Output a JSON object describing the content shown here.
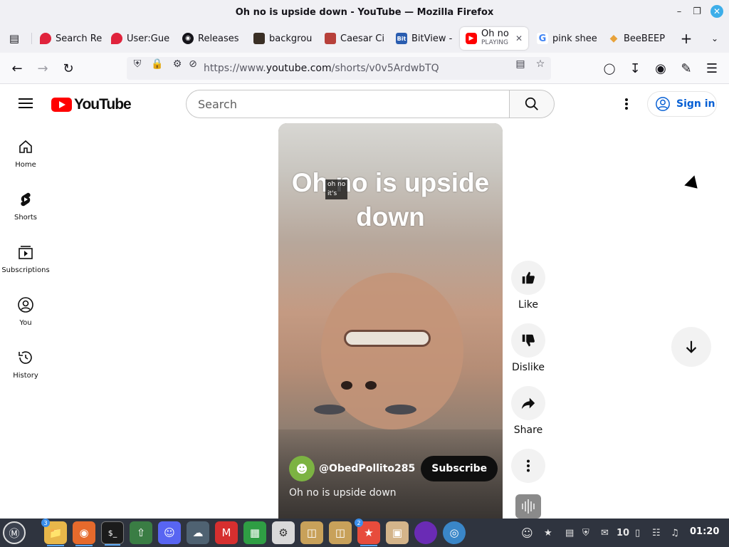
{
  "window": {
    "title": "Oh no is upside down - YouTube — Mozilla Firefox",
    "controls": [
      "minimize-icon",
      "maximize-icon",
      "close-icon"
    ]
  },
  "tabs": [
    {
      "label": "Search Re",
      "icon": "tinder-flame-icon",
      "color": "#e0233c"
    },
    {
      "label": "User:Gue",
      "icon": "tinder-flame-icon",
      "color": "#e0233c"
    },
    {
      "label": "Releases",
      "icon": "github-icon",
      "color": "#15141a"
    },
    {
      "label": "backgrou",
      "icon": "dark-favicon-icon",
      "color": "#3a2f25"
    },
    {
      "label": "Caesar Ci",
      "icon": "cipher-favicon-icon",
      "color": "#b7403a"
    },
    {
      "label": "BitView -",
      "icon": "bitview-icon",
      "color": "#2a5db0"
    },
    {
      "label": "Oh no",
      "sublabel": "PLAYING",
      "icon": "youtube-icon",
      "color": "#ff0000",
      "active": true
    },
    {
      "label": "pink shee",
      "icon": "google-icon",
      "color": "#4285f4"
    },
    {
      "label": "BeeBEEP",
      "icon": "diamond-icon",
      "color": "#e8a23a"
    }
  ],
  "navbar": {
    "url_prefix": "https://www.",
    "url_host": "youtube.com",
    "url_path": "/shorts/v0v5ArdwbTQ"
  },
  "youtube": {
    "logo_text": "YouTube",
    "search_placeholder": "Search",
    "sign_in": "Sign in",
    "sidebar": [
      {
        "label": "Home",
        "icon": "home-icon"
      },
      {
        "label": "Shorts",
        "icon": "shorts-icon"
      },
      {
        "label": "Subscriptions",
        "icon": "subscriptions-icon"
      },
      {
        "label": "You",
        "icon": "you-icon"
      },
      {
        "label": "History",
        "icon": "history-icon"
      }
    ],
    "short": {
      "overlay_title": "Oh no is upside down",
      "caption_tag_line1": "oh no",
      "caption_tag_line2": "it's",
      "channel": "@ObedPollito285",
      "subscribe": "Subscribe",
      "caption": "Oh no is upside down"
    },
    "actions": [
      {
        "label": "Like",
        "icon": "thumbs-up-icon"
      },
      {
        "label": "Dislike",
        "icon": "thumbs-down-icon"
      },
      {
        "label": "Share",
        "icon": "share-icon"
      },
      {
        "label": "",
        "icon": "more-vertical-icon"
      }
    ]
  },
  "taskbar": {
    "apps": [
      {
        "name": "files",
        "badge": "3"
      },
      {
        "name": "firefox"
      },
      {
        "name": "terminal"
      },
      {
        "name": "update-manager"
      },
      {
        "name": "discord"
      },
      {
        "name": "cloud"
      },
      {
        "name": "mario"
      },
      {
        "name": "spreadsheet"
      },
      {
        "name": "settings"
      },
      {
        "name": "folder"
      },
      {
        "name": "folder2"
      },
      {
        "name": "beebeep",
        "badge": "2"
      },
      {
        "name": "box"
      },
      {
        "name": "purple-orb"
      },
      {
        "name": "globe"
      }
    ],
    "tray_count": "10",
    "clock": "01:20"
  }
}
